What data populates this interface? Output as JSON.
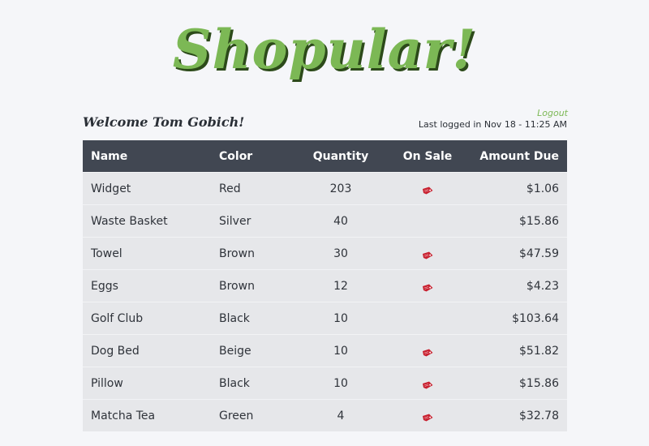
{
  "brand": {
    "title": "Shopular!",
    "color": "#7cb855"
  },
  "header": {
    "welcome": "Welcome Tom Gobich!",
    "logout_label": "Logout",
    "last_login": "Last logged in Nov 18 - 11:25 AM"
  },
  "table": {
    "columns": [
      "Name",
      "Color",
      "Quantity",
      "On Sale",
      "Amount Due"
    ],
    "rows": [
      {
        "name": "Widget",
        "color": "Red",
        "quantity": "203",
        "on_sale": true,
        "amount_due": "$1.06"
      },
      {
        "name": "Waste Basket",
        "color": "Silver",
        "quantity": "40",
        "on_sale": false,
        "amount_due": "$15.86"
      },
      {
        "name": "Towel",
        "color": "Brown",
        "quantity": "30",
        "on_sale": true,
        "amount_due": "$47.59"
      },
      {
        "name": "Eggs",
        "color": "Brown",
        "quantity": "12",
        "on_sale": true,
        "amount_due": "$4.23"
      },
      {
        "name": "Golf Club",
        "color": "Black",
        "quantity": "10",
        "on_sale": false,
        "amount_due": "$103.64"
      },
      {
        "name": "Dog Bed",
        "color": "Beige",
        "quantity": "10",
        "on_sale": true,
        "amount_due": "$51.82"
      },
      {
        "name": "Pillow",
        "color": "Black",
        "quantity": "10",
        "on_sale": true,
        "amount_due": "$15.86"
      },
      {
        "name": "Matcha Tea",
        "color": "Green",
        "quantity": "4",
        "on_sale": true,
        "amount_due": "$32.78"
      }
    ]
  },
  "icons": {
    "sale": "sale-tag-icon"
  },
  "colors": {
    "header_bg": "#414752",
    "row_bg": "#e6e7ea",
    "sale_tag": "#c8202f"
  }
}
